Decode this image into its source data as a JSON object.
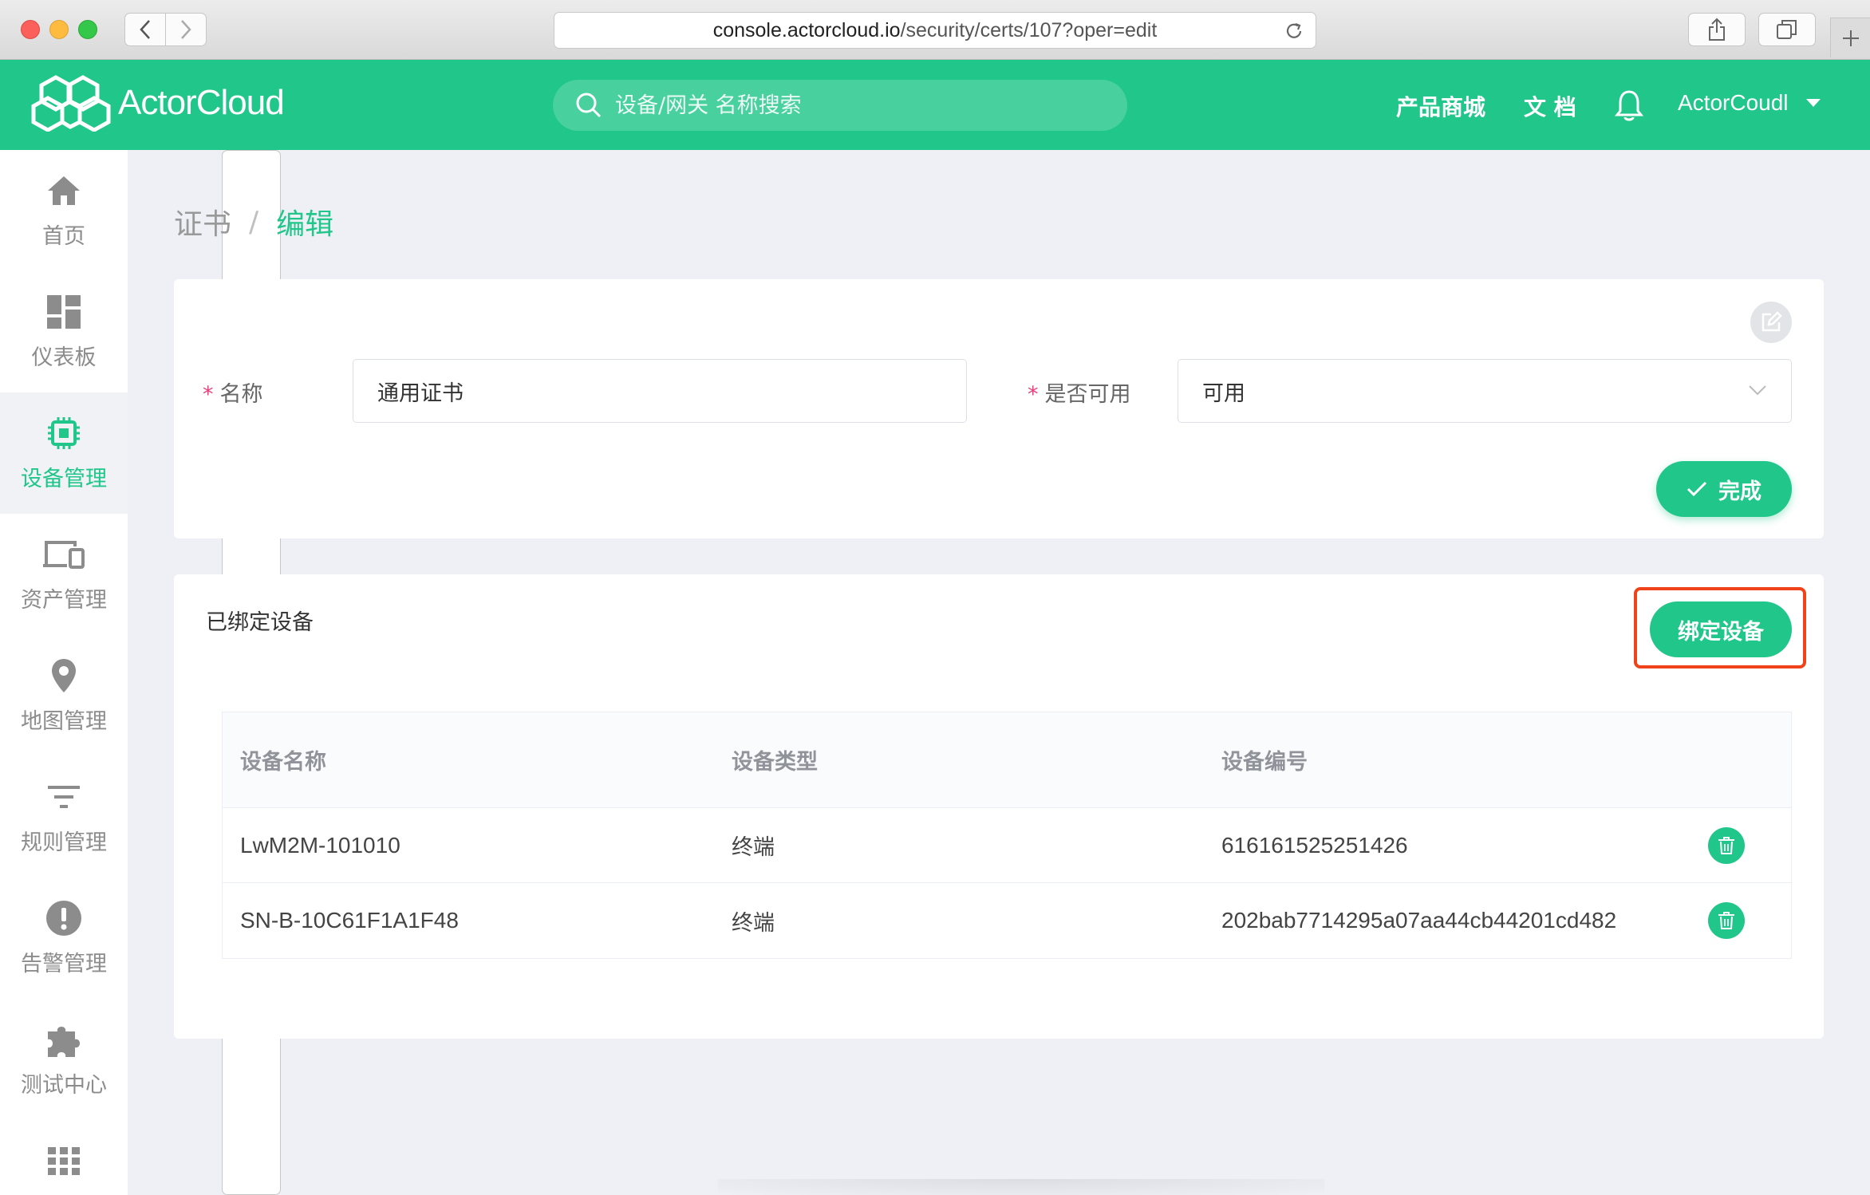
{
  "browser": {
    "url_host": "console.actorcloud.io",
    "url_path": "/security/certs/107?oper=edit"
  },
  "header": {
    "logo_text": "ActorCloud",
    "search_placeholder": "设备/网关 名称搜索",
    "nav_store": "产品商城",
    "nav_docs": "文 档",
    "user_name": "ActorCoudl"
  },
  "sidebar": {
    "items": [
      {
        "label": "首页",
        "icon": "home-icon"
      },
      {
        "label": "仪表板",
        "icon": "dashboard-icon"
      },
      {
        "label": "设备管理",
        "icon": "chip-icon",
        "active": true
      },
      {
        "label": "资产管理",
        "icon": "devices-icon"
      },
      {
        "label": "地图管理",
        "icon": "map-pin-icon"
      },
      {
        "label": "规则管理",
        "icon": "filter-icon"
      },
      {
        "label": "告警管理",
        "icon": "alert-icon"
      },
      {
        "label": "测试中心",
        "icon": "puzzle-icon"
      }
    ]
  },
  "breadcrumb": {
    "parent": "证书",
    "separator": "/",
    "current": "编辑"
  },
  "form": {
    "name_label": "名称",
    "name_value": "通用证书",
    "enable_label": "是否可用",
    "enable_value": "可用",
    "required_mark": "*",
    "done_label": "完成"
  },
  "bound": {
    "title": "已绑定设备",
    "bind_button": "绑定设备",
    "columns": [
      "设备名称",
      "设备类型",
      "设备编号"
    ],
    "rows": [
      {
        "name": "LwM2M-101010",
        "type": "终端",
        "id": "616161525251426"
      },
      {
        "name": "SN-B-10C61F1A1F48",
        "type": "终端",
        "id": "202bab7714295a07aa44cb44201cd482"
      }
    ]
  },
  "colors": {
    "brand": "#20c68a",
    "highlight": "#f0431c",
    "required": "#f03c7a"
  }
}
